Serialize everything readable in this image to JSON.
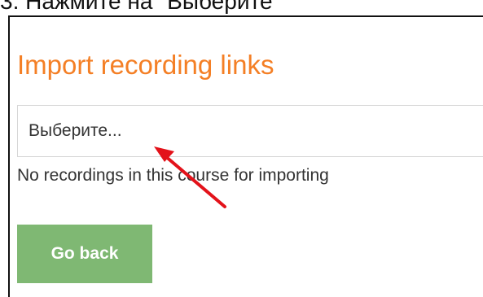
{
  "instruction": {
    "text": "3. Нажмите на \"Выберите\""
  },
  "import_recordings": {
    "title": "Import recording links",
    "select": {
      "placeholder": "Выберите..."
    },
    "message": "No recordings in this course for importing",
    "go_back_label": "Go back"
  },
  "annotation": {
    "arrow_color": "#e3121a"
  },
  "colors": {
    "title": "#f47f25",
    "button_bg": "#7fb873",
    "button_text": "#ffffff",
    "body_text": "#333333"
  }
}
